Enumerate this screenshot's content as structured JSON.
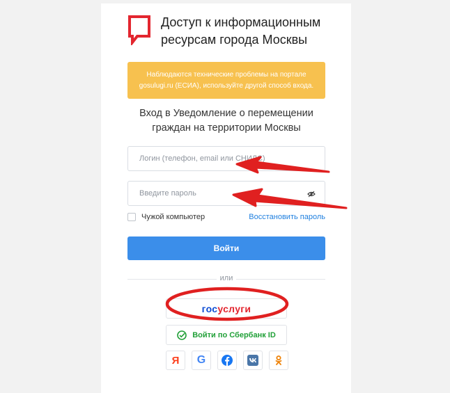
{
  "header": {
    "title": "Доступ к информационным ресурсам города Москвы"
  },
  "warning": {
    "text": "Наблюдаются технические проблемы на портале gosulugi.ru (ЕСИА), используйте другой способ входа."
  },
  "form": {
    "subtitle": "Вход в Уведомление о перемещении граждан на территории Москвы",
    "login_placeholder": "Логин (телефон, email или СНИЛС)",
    "login_value": "",
    "password_placeholder": "Введите пароль",
    "password_value": "",
    "remember_label": "Чужой компьютер",
    "remember_checked": false,
    "restore_label": "Восстановить пароль",
    "submit_label": "Войти"
  },
  "alt": {
    "or_label": "или",
    "gosuslugi_part1": "гос",
    "gosuslugi_part2": "услуги",
    "sber_label": "Войти по Сбербанк ID"
  },
  "social": [
    {
      "name": "yandex",
      "icon": "yandex-icon",
      "glyph": "Я",
      "color": "#fc3f1d"
    },
    {
      "name": "google",
      "icon": "google-icon",
      "glyph": "G",
      "color": "#4285f4"
    },
    {
      "name": "facebook",
      "icon": "facebook-icon",
      "color": "#1877f2"
    },
    {
      "name": "vk",
      "icon": "vk-icon",
      "color": "#4a76a8"
    },
    {
      "name": "odnoklassniki",
      "icon": "ok-icon",
      "color": "#ee8208"
    }
  ],
  "colors": {
    "accent": "#3b8eea",
    "warning": "#f7c14f",
    "brand_red": "#e3262f",
    "annotation_red": "#e02020",
    "link": "#1e7fdf",
    "sber_green": "#21a038"
  }
}
